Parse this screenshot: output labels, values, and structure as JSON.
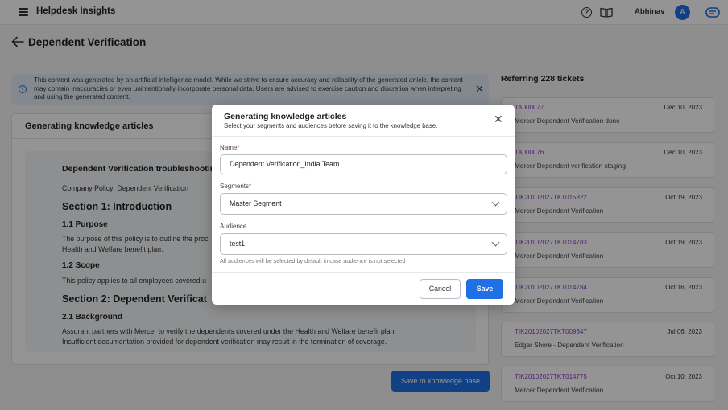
{
  "app": {
    "title": "Helpdesk Insights",
    "user_name": "Abhinav",
    "avatar_initial": "A",
    "help_glyph": "?"
  },
  "page": {
    "title": "Dependent Verification"
  },
  "banner": {
    "text": "This content was generated by an artificial intelligence model. While we strive to ensure accuracy and reliability of the generated article, the content may contain inaccuracies or even unintentionally incorporate personal data. Users are advised to exercise caution and discretion when interpreting and using the generated content.",
    "close": "✕",
    "info_glyph": "i"
  },
  "article": {
    "heading": "Generating knowledge articles",
    "title": "Dependent Verification troubleshootin",
    "policy": "Company Policy: Dependent Verification",
    "s1": "Section 1: Introduction",
    "s1_1": "1.1 Purpose",
    "purpose_l1": "The purpose of this policy is to outline the proc",
    "purpose_l2": "Health and Welfare benefit plan.",
    "s1_2": "1.2 Scope",
    "scope": "This policy applies to all employees covered u",
    "s2": "Section 2: Dependent Verificat",
    "s2_1": "2.1 Background",
    "bg_l1": "Assurant partners with Mercer to verify the dependents covered under the Health and Welfare benefit plan.",
    "bg_l2": "Insufficient documentation provided for dependent verification may result in the termination of coverage."
  },
  "save_kb_label": "Save to knowledge base",
  "tickets": {
    "title": "Referring 228 tickets",
    "items": [
      {
        "id": "TA000077",
        "date": "Dec 10, 2023",
        "desc": "Mercer Dependent Verification done"
      },
      {
        "id": "TA000076",
        "date": "Dec 10, 2023",
        "desc": "Mercer Dependent verification staging"
      },
      {
        "id": "TIK20102027TKT015822",
        "date": "Oct 19, 2023",
        "desc": "Mercer Dependent Verification"
      },
      {
        "id": "TIK20102027TKT014783",
        "date": "Oct 19, 2023",
        "desc": "Mercer Dependent Verification"
      },
      {
        "id": "TIK20102027TKT014784",
        "date": "Oct 16, 2023",
        "desc": "Mercer Dependent Verification"
      },
      {
        "id": "TIK20102027TKT009347",
        "date": "Jul 06, 2023",
        "desc": "Edgar Shore - Dependent Verification"
      },
      {
        "id": "TIK20102027TKT014775",
        "date": "Oct 10, 2023",
        "desc": "Mercer Dependent Verification"
      }
    ]
  },
  "modal": {
    "title": "Generating knowledge articles",
    "subtitle": "Select your segments and audiences before saving it to the knowledge base.",
    "close": "✕",
    "required_mark": "*",
    "name_label": "Name",
    "name_value": "Dependent Verification_India Team",
    "segments_label": "Segments",
    "segments_value": "Master Segment",
    "audience_label": "Audience",
    "audience_value": "test1",
    "hint": "All audiences will be selected by default in case audience is not selected",
    "cancel": "Cancel",
    "save": "Save"
  },
  "colors": {
    "primary": "#1f6fe5",
    "ticket_id": "#8e3bc7",
    "banner_bg": "#e3edf8"
  }
}
